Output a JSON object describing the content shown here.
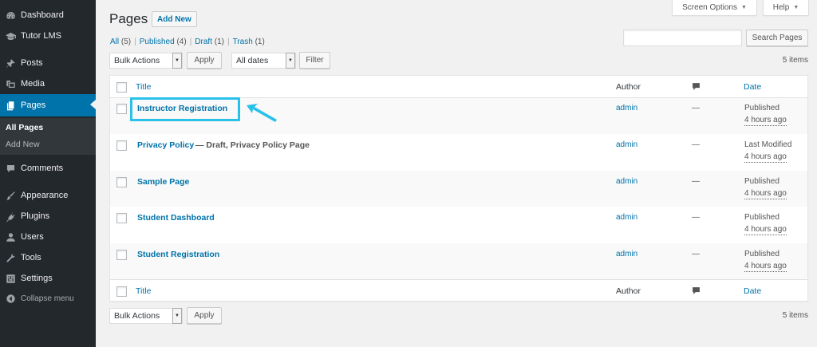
{
  "sidebar": {
    "items": [
      {
        "label": "Dashboard",
        "icon": "dashboard-icon"
      },
      {
        "label": "Tutor LMS",
        "icon": "graduation-cap-icon"
      },
      {
        "label": "Posts",
        "icon": "pushpin-icon"
      },
      {
        "label": "Media",
        "icon": "media-icon"
      },
      {
        "label": "Pages",
        "icon": "pages-icon"
      },
      {
        "label": "Comments",
        "icon": "comment-icon"
      },
      {
        "label": "Appearance",
        "icon": "paintbrush-icon"
      },
      {
        "label": "Plugins",
        "icon": "plug-icon"
      },
      {
        "label": "Users",
        "icon": "users-icon"
      },
      {
        "label": "Tools",
        "icon": "wrench-icon"
      },
      {
        "label": "Settings",
        "icon": "settings-icon"
      }
    ],
    "submenu": [
      {
        "label": "All Pages"
      },
      {
        "label": "Add New"
      }
    ],
    "collapse_label": "Collapse menu"
  },
  "screen_options": {
    "label": "Screen Options"
  },
  "help": {
    "label": "Help"
  },
  "header": {
    "title": "Pages",
    "add_new": "Add New"
  },
  "views": {
    "all": {
      "label": "All",
      "count": "(5)"
    },
    "published": {
      "label": "Published",
      "count": "(4)"
    },
    "draft": {
      "label": "Draft",
      "count": "(1)"
    },
    "trash": {
      "label": "Trash",
      "count": "(1)"
    },
    "separator": "|"
  },
  "search": {
    "button": "Search Pages",
    "value": ""
  },
  "filters": {
    "bulk_actions": "Bulk Actions",
    "apply": "Apply",
    "dates": "All dates",
    "filter": "Filter",
    "items_count": "5 items"
  },
  "table": {
    "columns": {
      "title": "Title",
      "author": "Author",
      "date": "Date"
    },
    "rows": [
      {
        "title": "Instructor Registration",
        "state": "",
        "author": "admin",
        "comments": "—",
        "status": "Published",
        "ago": "4 hours ago"
      },
      {
        "title": "Privacy Policy",
        "state": "— Draft, Privacy Policy Page",
        "author": "admin",
        "comments": "—",
        "status": "Last Modified",
        "ago": "4 hours ago"
      },
      {
        "title": "Sample Page",
        "state": "",
        "author": "admin",
        "comments": "—",
        "status": "Published",
        "ago": "4 hours ago"
      },
      {
        "title": "Student Dashboard",
        "state": "",
        "author": "admin",
        "comments": "—",
        "status": "Published",
        "ago": "4 hours ago"
      },
      {
        "title": "Student Registration",
        "state": "",
        "author": "admin",
        "comments": "—",
        "status": "Published",
        "ago": "4 hours ago"
      }
    ]
  },
  "bottom_filters": {
    "bulk_actions": "Bulk Actions",
    "apply": "Apply",
    "items_count": "5 items"
  },
  "colors": {
    "accent": "#0073aa",
    "sidebar": "#23282d",
    "highlight": "#29c1ea"
  }
}
